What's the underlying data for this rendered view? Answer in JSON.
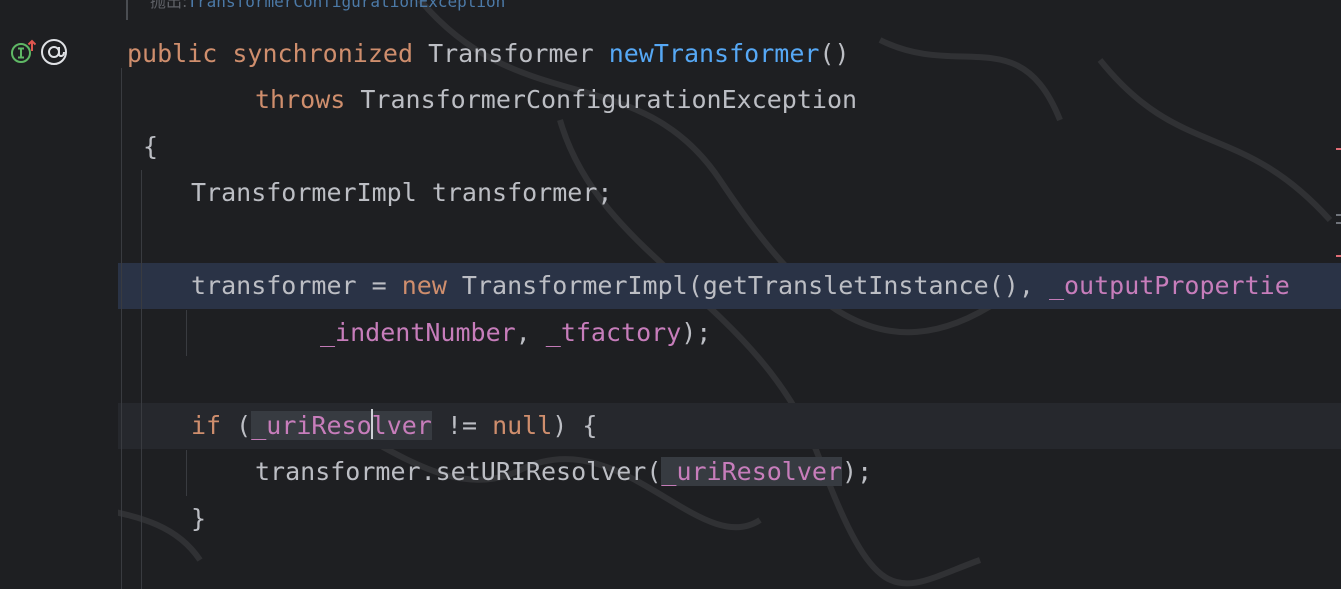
{
  "doc_hint": {
    "label": "抛出:",
    "exception_ref": "TransformerConfigurationException"
  },
  "code": {
    "line1": {
      "public": "public",
      "synchronized": "synchronized",
      "return_type": "Transformer",
      "method_name": "newTransformer",
      "parens": "()"
    },
    "line2": {
      "throws": "throws",
      "exception": "TransformerConfigurationException"
    },
    "line3": {
      "brace": "{"
    },
    "line4": {
      "text": "TransformerImpl transformer;"
    },
    "line5": {
      "lhs": "transformer = ",
      "new": "new",
      "call": " TransformerImpl(getTransletInstance(), ",
      "field": "_outputPropertie"
    },
    "line6": {
      "field1": "_indentNumber",
      "sep": ", ",
      "field2": "_tfactory",
      "tail": ");"
    },
    "line7": {
      "if": "if",
      "open": " (",
      "field_before_caret": "_uriReso",
      "field_after_caret": "lver",
      "op": " != ",
      "null": "null",
      "tail": ") {"
    },
    "line8": {
      "call": "transformer.setURIResolver(",
      "field": "_uriResolver",
      "tail": ");"
    },
    "line9": {
      "brace": "}"
    }
  },
  "gutter": {
    "icons": [
      "implements-up-arrow-icon",
      "at-annotation-icon"
    ]
  },
  "colors": {
    "background": "#1e1f22",
    "keyword": "#cf8e6d",
    "function": "#56a8f5",
    "field": "#c77dbb",
    "text": "#bcbec4",
    "selection_line": "#2a3346",
    "caret_line": "#26282d",
    "marker_red": "#e06c75",
    "marker_gray": "#6f737a"
  }
}
